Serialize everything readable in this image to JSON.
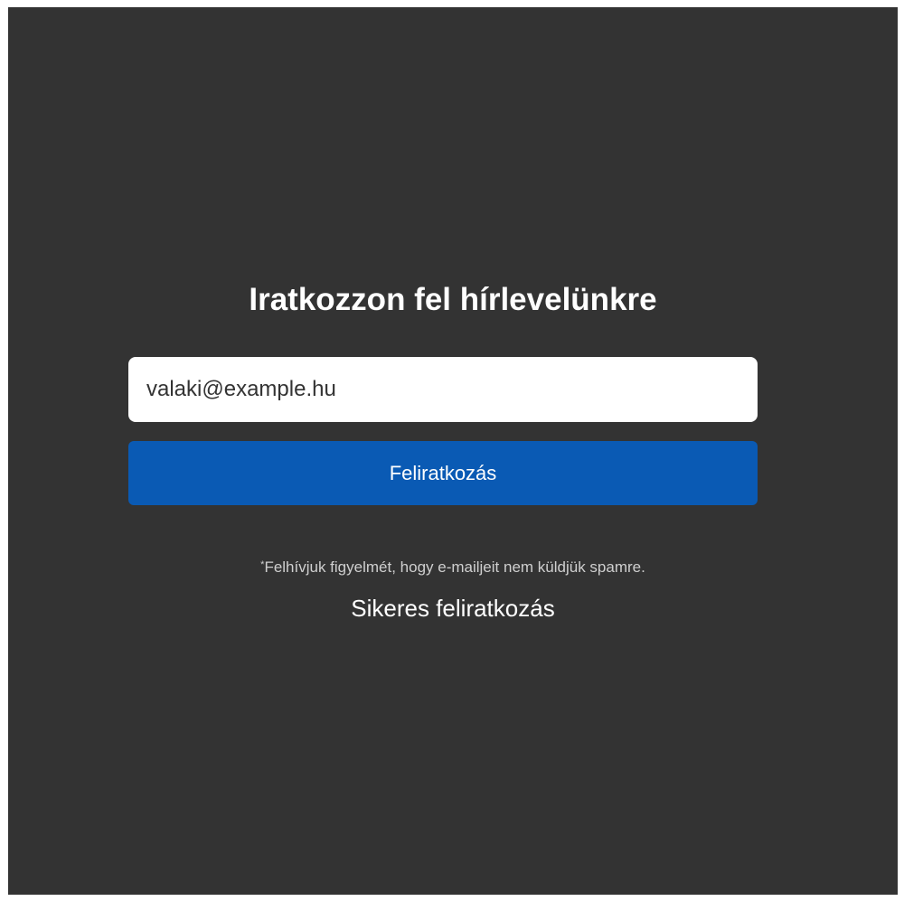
{
  "colors": {
    "page_background": "#ffffff",
    "panel_background": "#333333",
    "button_background": "#0a5ab4",
    "text_primary": "#ffffff",
    "text_note": "#cfcfcf"
  },
  "newsletter": {
    "title": "Iratkozzon fel hírlevelünkre",
    "email_value": "valaki@example.hu",
    "subscribe_label": "Feliratkozás",
    "note_marker": "*",
    "note_text": "Felhívjuk figyelmét, hogy e-mailjeit nem küldjük spamre.",
    "success_message": "Sikeres feliratkozás"
  }
}
